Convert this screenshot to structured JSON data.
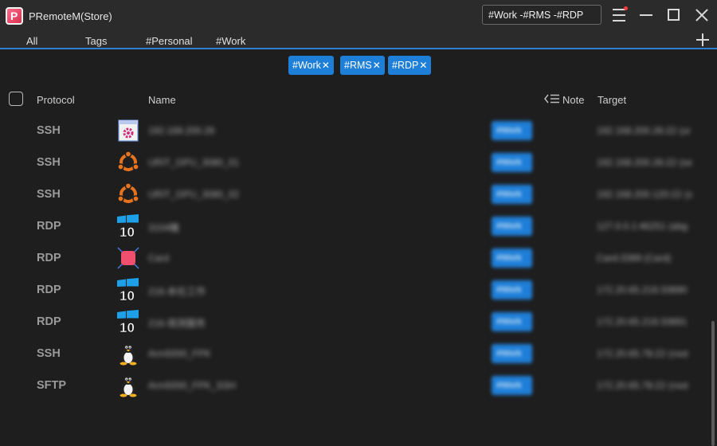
{
  "window": {
    "title": "PRemoteM(Store)",
    "logo_letter": "P"
  },
  "search": {
    "value": "#Work -#RMS -#RDP"
  },
  "tabs": [
    {
      "label": "All"
    },
    {
      "label": "Tags"
    },
    {
      "label": "#Personal"
    },
    {
      "label": "#Work"
    }
  ],
  "filters": [
    {
      "label": "#Work",
      "remove": "✕"
    },
    {
      "label": "#RMS",
      "remove": "✕"
    },
    {
      "label": "#RDP",
      "remove": "✕"
    }
  ],
  "columns": {
    "protocol": "Protocol",
    "name": "Name",
    "note": "Note",
    "target": "Target"
  },
  "colors": {
    "accent": "#1e7fd8",
    "background": "#1e1e1e",
    "titlebar": "#2b2b2b",
    "notification": "#ff3b3b"
  },
  "rows": [
    {
      "protocol": "SSH",
      "icon": "settings-window-icon",
      "name": "192.168.200.26",
      "note": "#Work",
      "target": "192.168.200.26:22 (ur"
    },
    {
      "protocol": "SSH",
      "icon": "ubuntu-icon",
      "name": "URIT_GPU_3080_01",
      "note": "#Work",
      "target": "192.168.200.26:22 (se"
    },
    {
      "protocol": "SSH",
      "icon": "ubuntu-icon",
      "name": "URIT_GPU_3080_02",
      "note": "#Work",
      "target": "192.168.200.120:22 (s"
    },
    {
      "protocol": "RDP",
      "icon": "windows10-icon",
      "name": "3104機",
      "note": "#Work",
      "target": "127.0.0.1:46251 (abg"
    },
    {
      "protocol": "RDP",
      "icon": "card-icon",
      "name": "Card",
      "note": "#Work",
      "target": "Card:3389 (Card)"
    },
    {
      "protocol": "RDP",
      "icon": "windows10-icon",
      "name": "216-本社工作",
      "note": "#Work",
      "target": "172.20.65.216:33890"
    },
    {
      "protocol": "RDP",
      "icon": "windows10-icon",
      "name": "216-观测服务",
      "note": "#Work",
      "target": "172.20.65.216:33891"
    },
    {
      "protocol": "SSH",
      "icon": "linux-tux-icon",
      "name": "Arm5000_FPK",
      "note": "#Work",
      "target": "172.20.65.78:22 (root"
    },
    {
      "protocol": "SFTP",
      "icon": "linux-tux-icon",
      "name": "Arm5000_FPK_SSH",
      "note": "#Work",
      "target": "172.20.65.78:22 (root"
    }
  ]
}
